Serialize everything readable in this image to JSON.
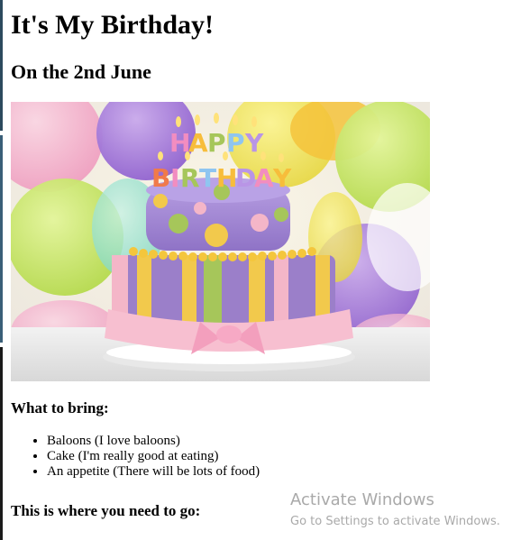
{
  "page": {
    "title": "It's My Birthday!",
    "subtitle": "On the 2nd June",
    "hero_image": {
      "icon": "birthday-cake-photo",
      "candle_text_top": "HAPPY",
      "candle_text_bottom": "BIRTHDAY"
    },
    "bring_heading": "What to bring:",
    "bring_items": [
      "Baloons (I love baloons)",
      "Cake (I'm really good at eating)",
      "An appetite (There will be lots of food)"
    ],
    "location_heading": "This is where you need to go:"
  },
  "watermark": {
    "title": "Activate Windows",
    "subtitle": "Go to Settings to activate Windows."
  },
  "colors": {
    "text": "#000000",
    "watermark": "#a9a9a9",
    "cake_purple": "#9b7fc9",
    "cake_pink": "#f4b6c8",
    "cake_yellow": "#f2c94c",
    "cake_green": "#a6c65a"
  }
}
